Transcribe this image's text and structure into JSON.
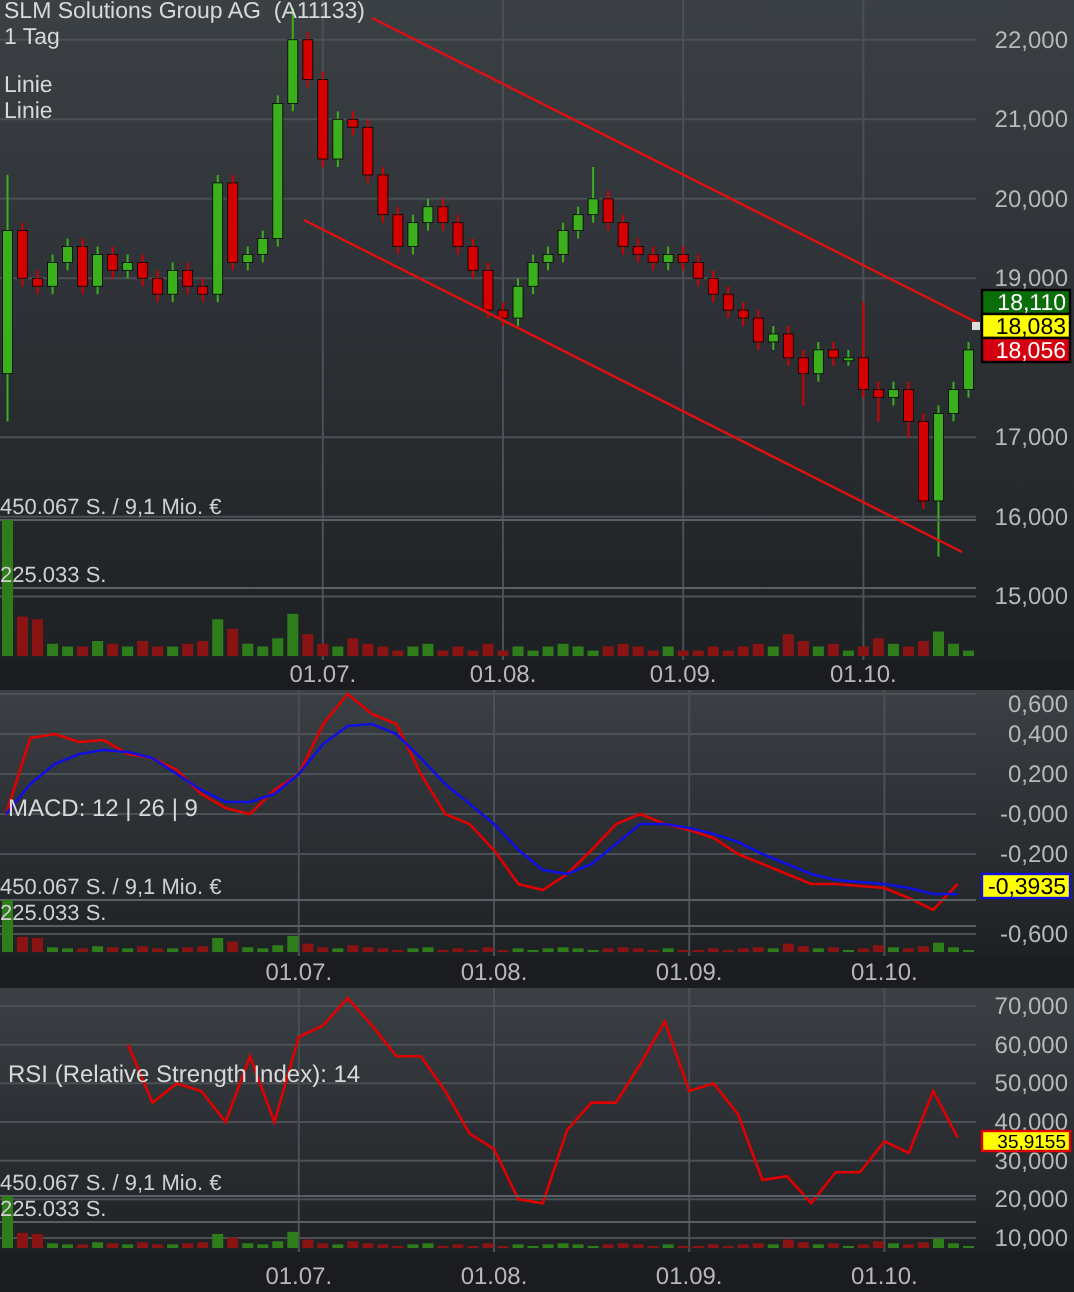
{
  "title": "SLM Solutions Group AG  (A11133)",
  "interval": "1 Tag",
  "legend": [
    "Linie",
    "Linie"
  ],
  "price_panel": {
    "badges": [
      {
        "text": "18,110",
        "color": "#0a6e0a"
      },
      {
        "text": "18,083",
        "color": "#ffff00"
      },
      {
        "text": "18,056",
        "color": "#d40010"
      }
    ],
    "chart_data": {
      "type": "candlestick",
      "grid": true,
      "ylim": [
        14.2,
        22.5
      ],
      "categories": [
        null,
        null,
        null,
        null,
        null,
        null,
        null,
        null,
        null,
        null,
        null,
        null,
        null,
        null,
        null,
        null,
        null,
        null,
        null,
        null,
        null,
        "01.07.",
        null,
        null,
        null,
        null,
        null,
        null,
        null,
        null,
        null,
        null,
        null,
        "01.08.",
        null,
        null,
        null,
        null,
        null,
        null,
        null,
        null,
        null,
        null,
        null,
        "01.09.",
        null,
        null,
        null,
        null,
        null,
        null,
        null,
        null,
        null,
        null,
        null,
        "01.10.",
        null,
        null,
        null,
        null,
        null,
        null,
        null
      ],
      "yticks": [
        {
          "value": 22,
          "label": "22,000"
        },
        {
          "value": 21,
          "label": "21,000"
        },
        {
          "value": 20,
          "label": "20,000"
        },
        {
          "value": 19,
          "label": "19,000"
        },
        {
          "value": 17,
          "label": "17,000"
        },
        {
          "value": 16,
          "label": "16,000"
        },
        {
          "value": 15,
          "label": "15,000"
        }
      ],
      "ohlc": [
        [
          17.8,
          20.3,
          17.2,
          19.6
        ],
        [
          19.6,
          19.7,
          18.9,
          19.0
        ],
        [
          19.0,
          19.1,
          18.8,
          18.9
        ],
        [
          18.9,
          19.3,
          18.8,
          19.2
        ],
        [
          19.2,
          19.5,
          19.1,
          19.4
        ],
        [
          19.4,
          19.5,
          18.8,
          18.9
        ],
        [
          18.9,
          19.4,
          18.8,
          19.3
        ],
        [
          19.3,
          19.4,
          19.0,
          19.1
        ],
        [
          19.1,
          19.3,
          19.0,
          19.2
        ],
        [
          19.2,
          19.3,
          18.9,
          19.0
        ],
        [
          19.0,
          19.1,
          18.7,
          18.8
        ],
        [
          18.8,
          19.2,
          18.7,
          19.1
        ],
        [
          19.1,
          19.2,
          18.8,
          18.9
        ],
        [
          18.9,
          19.0,
          18.7,
          18.8
        ],
        [
          18.8,
          20.3,
          18.7,
          20.2
        ],
        [
          20.2,
          20.3,
          19.1,
          19.2
        ],
        [
          19.2,
          19.4,
          19.1,
          19.3
        ],
        [
          19.3,
          19.6,
          19.2,
          19.5
        ],
        [
          19.5,
          21.3,
          19.4,
          21.2
        ],
        [
          21.2,
          22.4,
          21.1,
          22.0
        ],
        [
          22.0,
          22.1,
          21.4,
          21.5
        ],
        [
          21.5,
          21.6,
          20.4,
          20.5
        ],
        [
          20.5,
          21.1,
          20.4,
          21.0
        ],
        [
          21.0,
          21.1,
          20.8,
          20.9
        ],
        [
          20.9,
          21.0,
          20.2,
          20.3
        ],
        [
          20.3,
          20.4,
          19.7,
          19.8
        ],
        [
          19.8,
          19.9,
          19.3,
          19.4
        ],
        [
          19.4,
          19.8,
          19.3,
          19.7
        ],
        [
          19.7,
          20.0,
          19.6,
          19.9
        ],
        [
          19.9,
          20.0,
          19.6,
          19.7
        ],
        [
          19.7,
          19.8,
          19.3,
          19.4
        ],
        [
          19.4,
          19.5,
          19.0,
          19.1
        ],
        [
          19.1,
          19.2,
          18.5,
          18.6
        ],
        [
          18.6,
          18.7,
          18.4,
          18.5
        ],
        [
          18.5,
          19.0,
          18.4,
          18.9
        ],
        [
          18.9,
          19.3,
          18.8,
          19.2
        ],
        [
          19.2,
          19.4,
          19.1,
          19.3
        ],
        [
          19.3,
          19.7,
          19.2,
          19.6
        ],
        [
          19.6,
          19.9,
          19.5,
          19.8
        ],
        [
          19.8,
          20.4,
          19.7,
          20.0
        ],
        [
          20.0,
          20.1,
          19.6,
          19.7
        ],
        [
          19.7,
          19.8,
          19.3,
          19.4
        ],
        [
          19.4,
          19.5,
          19.2,
          19.3
        ],
        [
          19.3,
          19.4,
          19.1,
          19.2
        ],
        [
          19.2,
          19.4,
          19.1,
          19.3
        ],
        [
          19.3,
          19.4,
          19.1,
          19.2
        ],
        [
          19.2,
          19.3,
          18.9,
          19.0
        ],
        [
          19.0,
          19.1,
          18.7,
          18.8
        ],
        [
          18.8,
          18.9,
          18.5,
          18.6
        ],
        [
          18.6,
          18.7,
          18.4,
          18.5
        ],
        [
          18.5,
          18.6,
          18.1,
          18.2
        ],
        [
          18.2,
          18.4,
          18.1,
          18.3
        ],
        [
          18.3,
          18.4,
          17.9,
          18.0
        ],
        [
          18.0,
          18.1,
          17.4,
          17.8
        ],
        [
          17.8,
          18.2,
          17.7,
          18.1
        ],
        [
          18.1,
          18.2,
          17.9,
          18.0
        ],
        [
          18.0,
          18.1,
          17.9,
          18.0
        ],
        [
          18.0,
          18.7,
          17.5,
          17.6
        ],
        [
          17.6,
          17.7,
          17.2,
          17.5
        ],
        [
          17.5,
          17.7,
          17.4,
          17.6
        ],
        [
          17.6,
          17.7,
          17.0,
          17.2
        ],
        [
          17.2,
          17.3,
          16.1,
          16.2
        ],
        [
          16.2,
          17.4,
          15.5,
          17.3
        ],
        [
          17.3,
          17.7,
          17.2,
          17.6
        ],
        [
          17.6,
          18.2,
          17.5,
          18.1
        ]
      ]
    },
    "volume_labels": [
      "450.067 S. / 9,1 Mio. €",
      "225.033 S."
    ]
  },
  "macd_panel": {
    "label": "MACD: 12 | 26 | 9",
    "badges": [
      {
        "text": "-0,3935",
        "color": "#ffff00"
      }
    ],
    "chart_data": {
      "type": "line",
      "grid": true,
      "ylim": [
        -0.71,
        0.62
      ],
      "categories": [
        null,
        null,
        null,
        null,
        null,
        null,
        null,
        null,
        null,
        null,
        null,
        null,
        "01.07.",
        null,
        null,
        null,
        null,
        null,
        null,
        null,
        "01.08.",
        null,
        null,
        null,
        null,
        null,
        null,
        null,
        "01.09.",
        null,
        null,
        null,
        null,
        null,
        null,
        null,
        "01.10.",
        null,
        null,
        null
      ],
      "yticks": [
        {
          "value": 0.6,
          "label": "0,600"
        },
        {
          "value": 0.4,
          "label": "0,400"
        },
        {
          "value": 0.2,
          "label": "0,200"
        },
        {
          "value": 0,
          "label": "-0,000"
        },
        {
          "value": -0.2,
          "label": "-0,200"
        },
        {
          "value": -0.6,
          "label": "-0,600"
        }
      ],
      "series": [
        {
          "color": "#e00000",
          "values": [
            0.0,
            0.38,
            0.4,
            0.36,
            0.37,
            0.3,
            0.28,
            0.22,
            0.1,
            0.03,
            0.0,
            0.12,
            0.2,
            0.45,
            0.6,
            0.5,
            0.45,
            0.2,
            0.0,
            -0.05,
            -0.18,
            -0.35,
            -0.38,
            -0.3,
            -0.18,
            -0.05,
            0.0,
            -0.05,
            -0.08,
            -0.12,
            -0.2,
            -0.25,
            -0.3,
            -0.35,
            -0.35,
            -0.36,
            -0.37,
            -0.42,
            -0.48,
            -0.35
          ]
        },
        {
          "color": "#1010e0",
          "values": [
            0.0,
            0.15,
            0.25,
            0.3,
            0.32,
            0.31,
            0.28,
            0.2,
            0.12,
            0.06,
            0.06,
            0.1,
            0.2,
            0.35,
            0.44,
            0.45,
            0.4,
            0.28,
            0.15,
            0.05,
            -0.05,
            -0.18,
            -0.28,
            -0.3,
            -0.25,
            -0.15,
            -0.05,
            -0.05,
            -0.07,
            -0.1,
            -0.14,
            -0.2,
            -0.25,
            -0.3,
            -0.33,
            -0.34,
            -0.35,
            -0.37,
            -0.4,
            -0.4
          ]
        }
      ]
    },
    "volume_labels": [
      "450.067 S. / 9,1 Mio. €",
      "225.033 S."
    ]
  },
  "rsi_panel": {
    "label": "RSI (Relative Strength Index): 14",
    "badges": [
      {
        "text": "35,9155",
        "color": "#ffff00"
      }
    ],
    "chart_data": {
      "type": "line",
      "grid": true,
      "ylim": [
        6.37,
        74.66
      ],
      "categories": [
        null,
        null,
        null,
        null,
        null,
        null,
        null,
        null,
        null,
        null,
        null,
        null,
        "01.07.",
        null,
        null,
        null,
        null,
        null,
        null,
        null,
        "01.08.",
        null,
        null,
        null,
        null,
        null,
        null,
        null,
        "01.09.",
        null,
        null,
        null,
        null,
        null,
        null,
        null,
        "01.10.",
        null,
        null,
        null
      ],
      "yticks": [
        {
          "value": 70,
          "label": "70,000"
        },
        {
          "value": 60,
          "label": "60,000"
        },
        {
          "value": 50,
          "label": "50,000"
        },
        {
          "value": 40,
          "label": "40,000"
        },
        {
          "value": 30,
          "label": "30,000"
        },
        {
          "value": 20,
          "label": "20,000"
        },
        {
          "value": 10,
          "label": "10,000"
        }
      ],
      "series": [
        {
          "color": "#e00000",
          "values": [
            null,
            null,
            null,
            null,
            null,
            60,
            45,
            50,
            48,
            40,
            57,
            40,
            62,
            65,
            72,
            65,
            57,
            57,
            48,
            37,
            33,
            20,
            19,
            38,
            45,
            45,
            55,
            66,
            48,
            50,
            42,
            25,
            26,
            19,
            27,
            27,
            35,
            32,
            48,
            36
          ]
        }
      ]
    },
    "volume_labels": [
      "450.067 S. / 9,1 Mio. €",
      "225.033 S."
    ]
  }
}
